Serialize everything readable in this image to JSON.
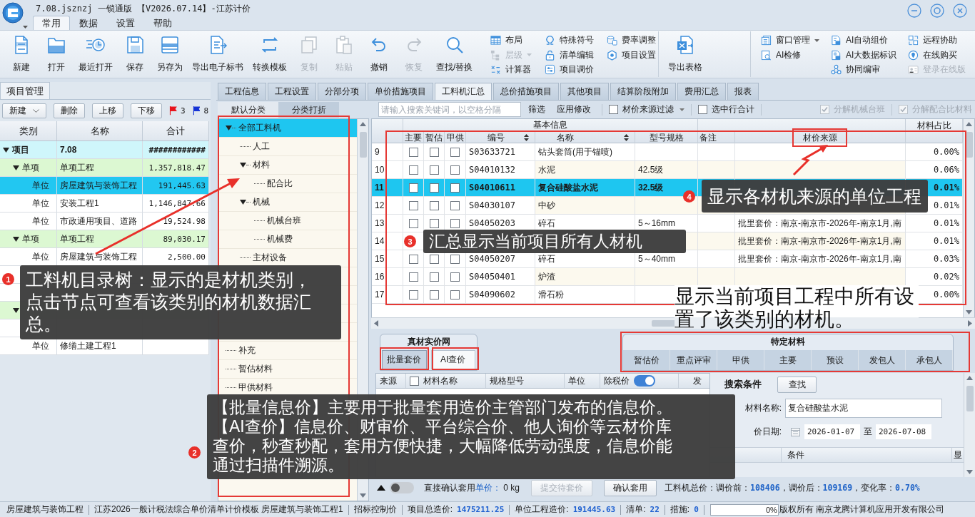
{
  "window": {
    "title": "7.08.jsznzj 一锁通版 【V2026.07.14】-江苏计价"
  },
  "menu_tabs": [
    {
      "label": "常用",
      "selected": true
    },
    {
      "label": "数据",
      "selected": false
    },
    {
      "label": "设置",
      "selected": false
    },
    {
      "label": "帮助",
      "selected": false
    }
  ],
  "ribbon": {
    "groups": [
      {
        "large_buttons": [
          {
            "label": "新建",
            "disabled": false
          },
          {
            "label": "打开",
            "disabled": false
          },
          {
            "label": "最近打开",
            "disabled": false
          },
          {
            "label": "保存",
            "disabled": false
          },
          {
            "label": "另存为",
            "disabled": false
          },
          {
            "label": "导出电子标书",
            "disabled": false
          },
          {
            "label": "转换模板",
            "disabled": false
          },
          {
            "label": "复制",
            "disabled": true
          },
          {
            "label": "粘贴",
            "disabled": true
          },
          {
            "label": "撤销",
            "disabled": false
          },
          {
            "label": "恢复",
            "disabled": true
          },
          {
            "label": "查找/替换",
            "disabled": false
          }
        ],
        "small_columns": [
          [
            {
              "label": "布局",
              "disabled": false,
              "dropdown": false
            },
            {
              "label": "层级",
              "disabled": true,
              "dropdown": true
            },
            {
              "label": "计算器",
              "disabled": false,
              "dropdown": false
            }
          ],
          [
            {
              "label": "特殊符号",
              "disabled": false,
              "dropdown": false
            },
            {
              "label": "清单编辑",
              "disabled": false,
              "dropdown": false
            },
            {
              "label": "项目调价",
              "disabled": false,
              "dropdown": false
            }
          ],
          [
            {
              "label": "费率调整",
              "disabled": false,
              "dropdown": false
            },
            {
              "label": "项目设置",
              "disabled": false,
              "dropdown": false
            }
          ]
        ]
      },
      {
        "large_buttons": [
          {
            "label": "导出表格",
            "disabled": false
          }
        ]
      },
      {
        "small_columns": [
          [
            {
              "label": "窗口管理",
              "disabled": false,
              "dropdown": true
            },
            {
              "label": "AI检修",
              "disabled": false,
              "dropdown": false
            }
          ],
          [
            {
              "label": "AI自动组价",
              "disabled": false,
              "dropdown": false
            },
            {
              "label": "AI大数据标识",
              "disabled": false,
              "dropdown": false
            },
            {
              "label": "协同编审",
              "disabled": false,
              "dropdown": false
            }
          ],
          [
            {
              "label": "远程协助",
              "disabled": false,
              "dropdown": false
            },
            {
              "label": "在线购买",
              "disabled": false,
              "dropdown": false
            },
            {
              "label": "登录在线版",
              "disabled": true,
              "dropdown": false
            }
          ]
        ]
      }
    ]
  },
  "project_panel": {
    "tab": "项目管理",
    "toolbar": [
      {
        "label": "新建",
        "dropdown": true
      },
      {
        "label": "删除",
        "dropdown": false
      },
      {
        "label": "上移",
        "dropdown": false
      },
      {
        "label": "下移",
        "dropdown": false
      }
    ],
    "flags": [
      {
        "color": "#e8141c",
        "count": "3"
      },
      {
        "color": "#1533d6",
        "count": "8"
      }
    ],
    "columns": [
      "类别",
      "名称",
      "合计"
    ],
    "rows": [
      {
        "category": "项目",
        "name": "7.08",
        "total": "############",
        "expanded": true,
        "selected": false,
        "children": [
          {
            "category": "单项",
            "name": "单项工程",
            "total": "1,357,818.47",
            "expanded": true,
            "selected": false,
            "children": [
              {
                "category": "单位",
                "name": "房屋建筑与装饰工程",
                "total": "191,445.63",
                "selected": true
              },
              {
                "category": "单位",
                "name": "安装工程1",
                "total": "1,146,847.66",
                "selected": false
              },
              {
                "category": "单位",
                "name": "市政通用项目、道路",
                "total": "19,524.98",
                "selected": false
              }
            ]
          },
          {
            "category": "单项",
            "name": "单项工程",
            "total": "89,030.17",
            "expanded": true,
            "selected": false,
            "children": [
              {
                "category": "单位",
                "name": "房屋建筑与装饰工程",
                "total": "2,500.00",
                "selected": false
              },
              {
                "selected": false
              },
              {
                "selected": false
              }
            ]
          },
          {
            "expanded": true,
            "selected": false,
            "children": [
              {
                "selected": false
              },
              {
                "category": "单位",
                "name": "修缮土建工程1",
                "selected": false
              }
            ]
          }
        ]
      }
    ]
  },
  "work_tabs": [
    {
      "label": "工程信息",
      "selected": false
    },
    {
      "label": "工程设置",
      "selected": false
    },
    {
      "label": "分部分项",
      "selected": false
    },
    {
      "label": "单价措施项目",
      "selected": false
    },
    {
      "label": "工料机汇总",
      "selected": true
    },
    {
      "label": "总价措施项目",
      "selected": false
    },
    {
      "label": "其他项目",
      "selected": false
    },
    {
      "label": "结算阶段附加",
      "selected": false
    },
    {
      "label": "费用汇总",
      "selected": false
    },
    {
      "label": "报表",
      "selected": false
    }
  ],
  "category_panel": {
    "tabs": [
      {
        "label": "默认分类",
        "selected": true
      },
      {
        "label": "分类打折",
        "selected": false
      }
    ],
    "tree": [
      {
        "label": "全部工料机",
        "expanded": true,
        "selected": true,
        "children": [
          {
            "label": "人工",
            "selected": false
          },
          {
            "label": "材料",
            "expanded": true,
            "selected": false,
            "children": [
              {
                "label": "配合比",
                "selected": false
              }
            ]
          },
          {
            "label": "机械",
            "expanded": true,
            "selected": false,
            "children": [
              {
                "label": "机械台班",
                "selected": false
              },
              {
                "label": "机械费",
                "selected": false
              }
            ]
          },
          {
            "label": "主材设备",
            "selected": false
          },
          {
            "selected": false
          },
          {
            "selected": false
          },
          {
            "selected": false
          }
        ]
      },
      {
        "selected": false
      },
      {
        "label": "补充",
        "selected": false
      },
      {
        "label": "暂估材料",
        "selected": false
      },
      {
        "label": "甲供材料",
        "selected": false
      }
    ]
  },
  "material_toolbar": {
    "search": {
      "placeholder": "请输入搜索关键词，以空格分隔"
    },
    "buttons": [
      "筛选",
      "应用修改"
    ],
    "filters": [
      {
        "label": "材价来源过滤",
        "checked": false,
        "dropdown": true
      },
      {
        "label": "选中行合计",
        "checked": false,
        "dropdown": false
      }
    ],
    "options": [
      {
        "label": "分解机械台班",
        "checked": true,
        "disabled": true
      },
      {
        "label": "分解配合比材料",
        "checked": true,
        "disabled": true
      }
    ]
  },
  "material_table": {
    "group_header": "基本信息",
    "columns": [
      {
        "label": "主要",
        "sortable": false
      },
      {
        "label": "暂估",
        "sortable": false
      },
      {
        "label": "甲供",
        "sortable": false
      },
      {
        "label": "编号",
        "sortable": true
      },
      {
        "label": "名称",
        "sortable": true
      },
      {
        "label": "型号规格",
        "sortable": false
      },
      {
        "label": "备注",
        "sortable": false
      },
      {
        "label": "材价来源",
        "sortable": false
      },
      {
        "label": "材料占比",
        "sortable": false
      }
    ],
    "rows": [
      {
        "no": "9",
        "checks": [
          false,
          false,
          false
        ],
        "code": "S03633721",
        "name": "钻头套筒(用于锚喷)",
        "share": "0.00%",
        "selected": false
      },
      {
        "no": "10",
        "checks": [
          false,
          false,
          false
        ],
        "code": "S04010132",
        "name": "水泥",
        "spec": "42.5级",
        "share": "0.06%",
        "selected": false
      },
      {
        "no": "11",
        "checks": [
          false,
          false,
          false
        ],
        "code": "S04010611",
        "name": "复合硅酸盐水泥",
        "spec": "32.5级",
        "share": "0.01%",
        "selected": true
      },
      {
        "no": "12",
        "checks": [
          false,
          false,
          false
        ],
        "code": "S04030107",
        "name": "中砂",
        "share": "0.01%",
        "selected": false
      },
      {
        "no": "13",
        "checks": [
          false,
          false,
          false
        ],
        "code": "S04050203",
        "name": "碎石",
        "spec": "5～16mm",
        "source": "批里套价：南京-南京市-2026年-南京1月,南",
        "share": "0.01%",
        "selected": false
      },
      {
        "no": "14",
        "source": "批里套价：南京-南京市-2026年-南京1月,南",
        "share": "0.01%",
        "selected": false
      },
      {
        "no": "15",
        "checks": [
          false,
          false,
          false
        ],
        "code": "S04050207",
        "name": "碎石",
        "spec": "5～40mm",
        "source": "批里套价：南京-南京市-2026年-南京1月,南",
        "share": "0.03%",
        "selected": false
      },
      {
        "no": "16",
        "checks": [
          false,
          false,
          false
        ],
        "code": "S04050401",
        "name": "炉渣",
        "share": "0.02%",
        "selected": false
      },
      {
        "no": "17",
        "checks": [
          false,
          false,
          false
        ],
        "code": "S04090602",
        "name": "滑石粉",
        "share": "0.00%",
        "selected": false
      }
    ]
  },
  "price_source": {
    "title": "真材实价网",
    "buttons": [
      {
        "label": "批量套价",
        "selected": true
      },
      {
        "label": "AI查价",
        "selected": false
      }
    ]
  },
  "special_materials": {
    "title": "特定材料",
    "tabs": [
      {
        "label": "暂估价",
        "selected": false
      },
      {
        "label": "重点评审",
        "selected": false
      },
      {
        "label": "甲供",
        "selected": false
      },
      {
        "label": "主要",
        "selected": false
      },
      {
        "label": "预设",
        "selected": false
      },
      {
        "label": "发包人",
        "selected": false
      },
      {
        "label": "承包人",
        "selected": false
      }
    ]
  },
  "result_table": {
    "columns": [
      "来源",
      "材料名称",
      "规格型号",
      "单位",
      "除税价",
      "发"
    ],
    "select_all": {
      "checked": false
    },
    "tax_toggle": {
      "on": true
    }
  },
  "search_pane": {
    "title": "搜索条件",
    "button": "查找",
    "name_field": {
      "label": "材料名称:",
      "value": "复合硅酸盐水泥"
    },
    "date": {
      "label": "价日期:",
      "from": "2026-01-07",
      "separator": "至",
      "to": "2026-07-08"
    },
    "columns": [
      "条件",
      "显"
    ]
  },
  "apply_bar": {
    "toggle": {
      "on": false
    },
    "label": "直接确认套用",
    "unit_link": "单价：",
    "value": "0",
    "unit": "kg",
    "buttons": [
      {
        "label": "提交待套价",
        "disabled": true
      },
      {
        "label": "确认套用",
        "disabled": false
      }
    ],
    "summary": [
      {
        "label": "工料机总价：调价前：",
        "value": "108406"
      },
      {
        "label": "，调价后：",
        "value": "109169"
      },
      {
        "label": "，变化率：",
        "value": "0.70%"
      }
    ]
  },
  "status_bar": {
    "items": [
      {
        "label": "房屋建筑与装饰工程"
      },
      {
        "label": "江苏2026一般计税法综合单价清单计价模板 房屋建筑与装饰工程1"
      },
      {
        "label": "招标控制价"
      },
      {
        "label": "项目总造价:",
        "value": "1475211.25"
      },
      {
        "label": "单位工程造价:",
        "value": "191445.63"
      },
      {
        "label": "清单:",
        "value": "22"
      },
      {
        "label": "措施:",
        "value": "0"
      }
    ],
    "progress": {
      "level": 0,
      "text": "0%"
    },
    "copyright": "版权所有 南京龙腾计算机应用开发有限公司"
  },
  "annotations": [
    {
      "kind": "callout",
      "badge": "1",
      "paragraphs": [
        "工料机目录树：显示的是材机类别，点击节点可查看该类别的材机数据汇总。"
      ]
    },
    {
      "kind": "callout",
      "badge": "2",
      "paragraphs": [
        "【批量信息价】主要用于批量套用造价主管部门发布的信息价。",
        "【AI查价】信息价、财审价、平台综合价、他人询价等云材价库查价，秒查秒配，套用方便快捷，大幅降低劳动强度，信息价能通过扫描件溯源。"
      ]
    },
    {
      "kind": "callout",
      "badge": "3",
      "paragraphs": [
        "汇总显示当前项目所有人材机"
      ]
    },
    {
      "kind": "callout",
      "badge": "4",
      "paragraphs": [
        "显示各材机来源的单位工程"
      ]
    },
    {
      "kind": "note",
      "paragraphs": [
        "显示当前项目工程中所有设置了该类别的材机。"
      ]
    }
  ]
}
